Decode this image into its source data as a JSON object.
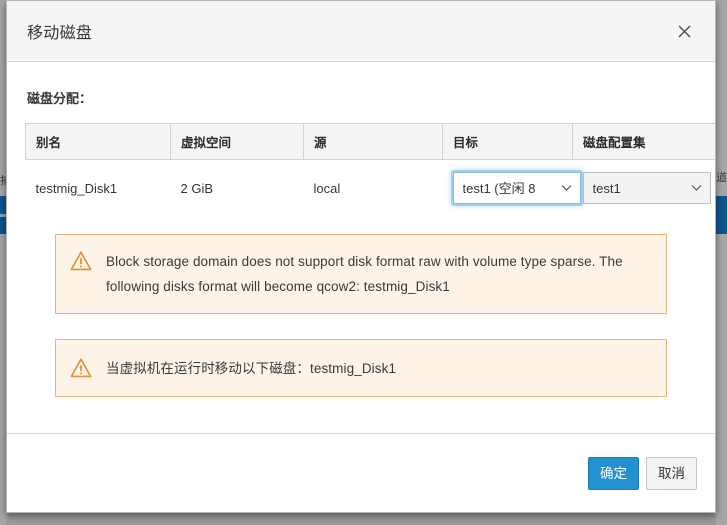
{
  "dialog": {
    "title": "移动磁盘",
    "close_label": "×",
    "section_label": "磁盘分配："
  },
  "table": {
    "headers": [
      "别名",
      "虚拟空间",
      "源",
      "目标",
      "磁盘配置集"
    ],
    "rows": [
      {
        "alias": "testmig_Disk1",
        "virtual_size": "2 GiB",
        "source": "local",
        "target_selected": "test1 (空闲 8",
        "profile_selected": "test1"
      }
    ]
  },
  "alerts": [
    {
      "icon": "warning-triangle-icon",
      "text": "Block storage domain does not support disk format raw with volume type sparse. The following disks format will become qcow2: testmig_Disk1"
    },
    {
      "icon": "warning-triangle-icon",
      "text": "当虚拟机在运行时移动以下磁盘：testmig_Disk1"
    }
  ],
  "footer": {
    "ok_label": "确定",
    "cancel_label": "取消"
  },
  "colors": {
    "primary_button": "#2391cf",
    "alert_bg": "#fdf3e7",
    "alert_border": "#ecb47c",
    "warning_icon": "#e08e37",
    "header_bg": "#f5f5f5",
    "focus_ring": "#82bee8"
  },
  "backdrop": {
    "left_fragment": "捕",
    "right_fragment": "道"
  }
}
